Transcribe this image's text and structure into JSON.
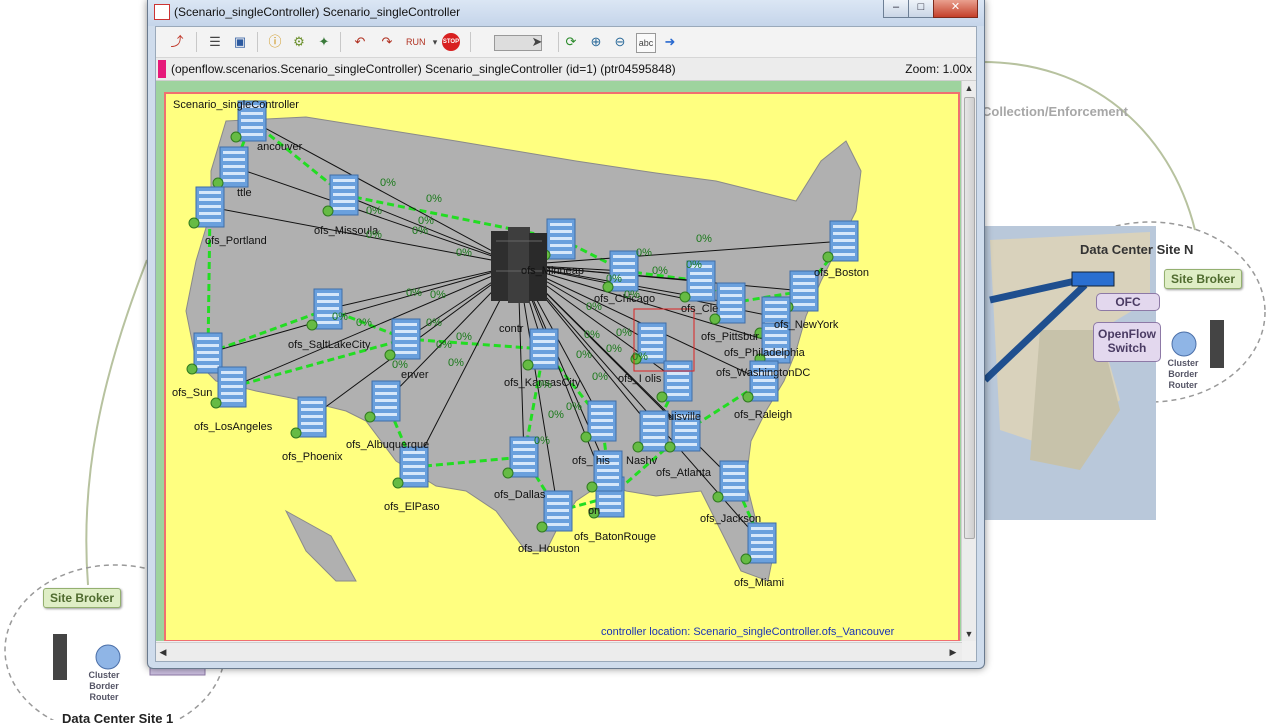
{
  "window": {
    "title": "(Scenario_singleController) Scenario_singleController",
    "controls": {
      "minimize": "–",
      "maximize": "□",
      "close": "✕"
    }
  },
  "toolbar": {
    "icons": [
      "rebuild-icon",
      "list-icon",
      "inspect-icon",
      "info-icon",
      "options-icon",
      "layout-icon",
      "step-back-icon",
      "fast-icon",
      "run-icon",
      "stop-icon",
      "slider-icon",
      "refresh-icon",
      "zoom-in-icon",
      "zoom-out-icon",
      "labels-icon",
      "arrow-icon"
    ],
    "run_label": "RUN",
    "stop_label": "STOP",
    "abc_label": "abc"
  },
  "infobar": {
    "path": "(openflow.scenarios.Scenario_singleController) Scenario_singleController  (id=1)  (ptr04595848)",
    "zoom": "Zoom: 1.00x"
  },
  "canvas": {
    "scenario_label": "Scenario_singleController",
    "controller_location": "controller location: Scenario_singleController.ofs_Vancouver",
    "controller_label": "contr",
    "map_color": "#b0b0b0",
    "background_color": "#ffff80",
    "link_color": "#22dd22",
    "nodes": [
      {
        "id": "ofs_Vancouver",
        "label": "ancouver"
      },
      {
        "id": "ofs_Seattle",
        "label": "ttle"
      },
      {
        "id": "ofs_Portland",
        "label": "ofs_Portland"
      },
      {
        "id": "ofs_Missoula",
        "label": "ofs_Missoula"
      },
      {
        "id": "ofs_Minneapolis",
        "label": "ofs_Minneap"
      },
      {
        "id": "ofs_Boston",
        "label": "ofs_Boston"
      },
      {
        "id": "ofs_NewYork",
        "label": "ofs_NewYork"
      },
      {
        "id": "ofs_Philadelphia",
        "label": "ofs_Philadelphia"
      },
      {
        "id": "ofs_Pittsburgh",
        "label": "ofs_Pittsbur"
      },
      {
        "id": "ofs_WashingtonDC",
        "label": "ofs_WashingtonDC"
      },
      {
        "id": "ofs_Cleveland",
        "label": "ofs_Cle"
      },
      {
        "id": "ofs_Chicago",
        "label": "ofs_Chicago"
      },
      {
        "id": "ofs_Indianapolis",
        "label": "ofs_I     olis"
      },
      {
        "id": "ofs_Louisville",
        "label": "uisville"
      },
      {
        "id": "ofs_SaltLakeCity",
        "label": "ofs_SaltLakeCity"
      },
      {
        "id": "ofs_Denver",
        "label": "enver"
      },
      {
        "id": "ofs_KansasCity",
        "label": "ofs_KansasCity"
      },
      {
        "id": "ofs_SanFrancisco",
        "label": "ofs_Sun"
      },
      {
        "id": "ofs_LosAngeles",
        "label": "ofs_LosAngeles"
      },
      {
        "id": "ofs_Phoenix",
        "label": "ofs_Phoenix"
      },
      {
        "id": "ofs_Albuquerque",
        "label": "ofs_Albuquerque"
      },
      {
        "id": "ofs_ElPaso",
        "label": "ofs_ElPaso"
      },
      {
        "id": "ofs_Dallas",
        "label": "ofs_Dallas"
      },
      {
        "id": "ofs_Houston",
        "label": "ofs_Houston"
      },
      {
        "id": "ofs_BatonRouge",
        "label": "ofs_BatonRouge"
      },
      {
        "id": "ofs_NewOrleans",
        "label": "on"
      },
      {
        "id": "ofs_Memphis",
        "label": "ofs_    his"
      },
      {
        "id": "ofs_Nashville",
        "label": "Nashv"
      },
      {
        "id": "ofs_Atlanta",
        "label": "ofs_Atlanta"
      },
      {
        "id": "ofs_Raleigh",
        "label": "ofs_Raleigh"
      },
      {
        "id": "ofs_Jacksonville",
        "label": "ofs_Jackson"
      },
      {
        "id": "ofs_Miami",
        "label": "ofs_Miami"
      }
    ],
    "link_percent_label": "0%"
  },
  "background": {
    "collection_label": "Collection/Enforcement",
    "dc_site_n": "Data Center Site N",
    "dc_site_1": "Data Center Site 1",
    "site_broker": "Site Broker",
    "ofc": "OFC",
    "openflow_switch": "OpenFlow Switch",
    "cluster_border_router": "Cluster Border Router"
  }
}
